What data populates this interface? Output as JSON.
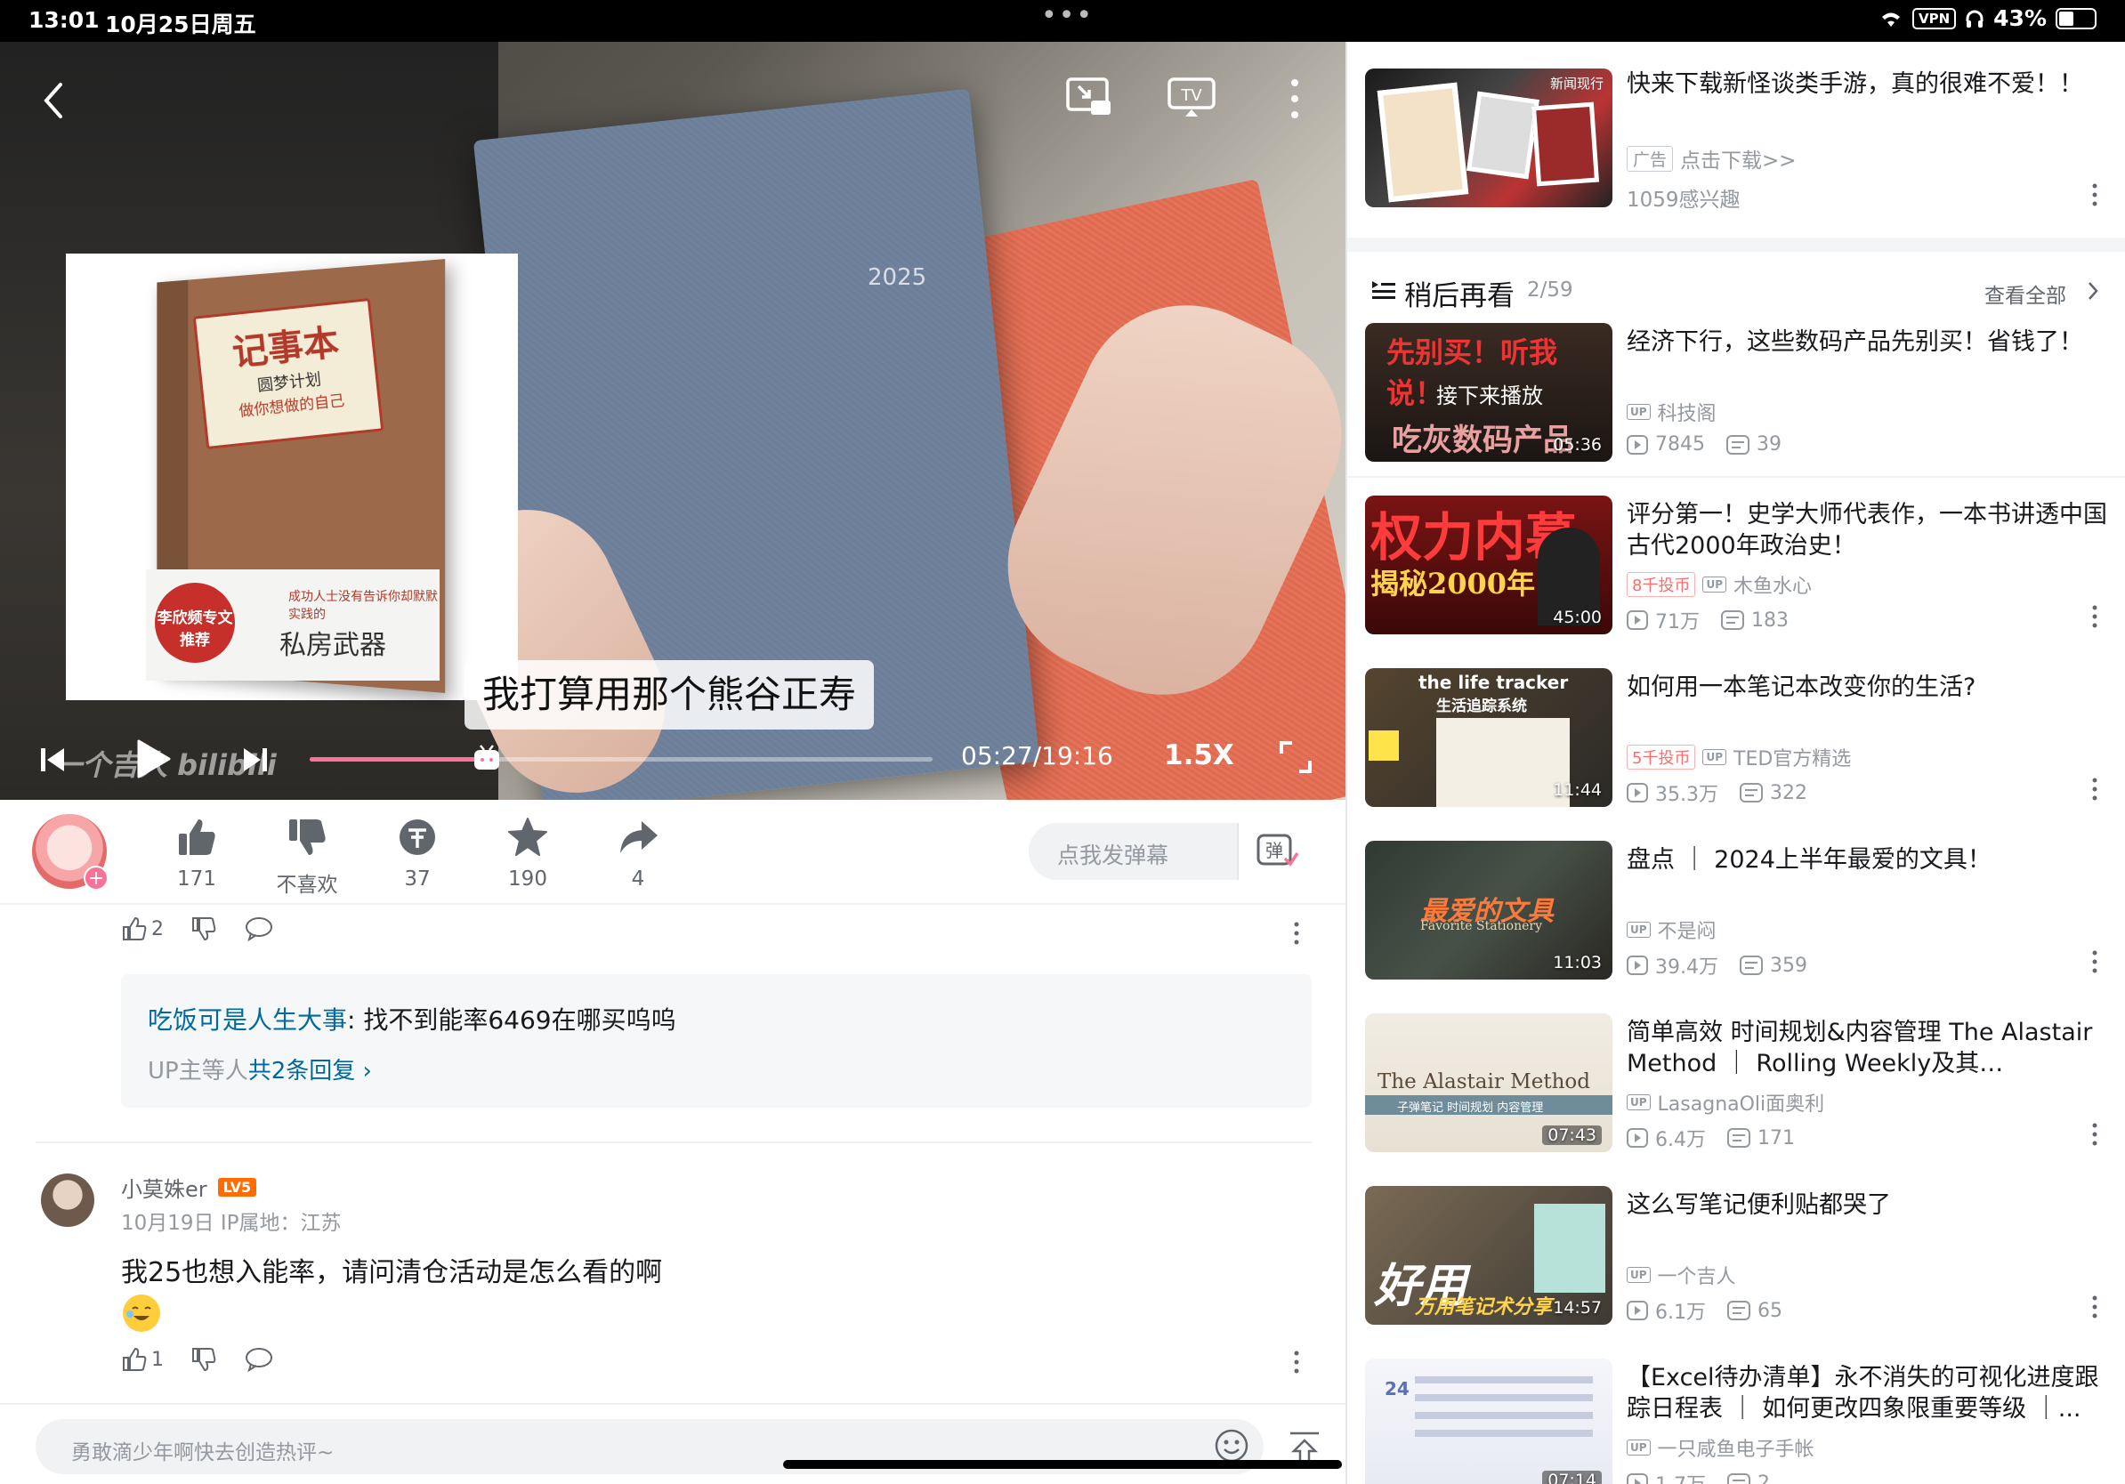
{
  "status_bar": {
    "time": "13:01",
    "date": "10月25日周五",
    "vpn": "VPN",
    "battery": "43%",
    "battery_level": 0.43
  },
  "player": {
    "subtitle": "我打算用那个熊谷正寿",
    "notebook_year": "2025",
    "book": {
      "title": "记事本",
      "subtitle": "圆梦计划",
      "tagline": "做你想做的自己",
      "cover_text": "成功人士没有告诉你却默默实践的",
      "cover_big": "私房武器",
      "stamp": "李欣频专文推荐"
    },
    "watermark": "一个吉人 bilibili",
    "time": "05:27/19:16",
    "progress": 0.284,
    "speed": "1.5X"
  },
  "actions": {
    "like_count": "171",
    "dislike_label": "不喜欢",
    "coin_count": "37",
    "fav_count": "190",
    "share_count": "4",
    "danmaku_placeholder": "点我发弹幕",
    "danmaku_btn": "弹"
  },
  "comments": {
    "first": {
      "likes": "2"
    },
    "reply_preview": {
      "name": "吃饭可是人生大事",
      "text": ": 找不到能率6469在哪买呜呜",
      "more_prefix": "UP主等人",
      "more_count": "共2条回复",
      "more_chevron": "›"
    },
    "second": {
      "user": "小莫姝er",
      "level": "LV5",
      "meta": "10月19日  IP属地：江苏",
      "text": "我25也想入能率，请问清仓活动是怎么看的啊",
      "likes": "1"
    },
    "input_placeholder": "勇敢滴少年啊快去创造热评~"
  },
  "sidebar": {
    "ad": {
      "title": "快来下载新怪谈类手游，真的很难不爱！！",
      "badge": "广告",
      "link": "点击下载>>",
      "interest": "1059感兴趣",
      "thumb_text": "新闻现行"
    },
    "later": {
      "title": "稍后再看",
      "count": "2/59",
      "view_all": "查看全部"
    },
    "videos": [
      {
        "title": "经济下行，这些数码产品先别买！省钱了！",
        "thumb_text": "先别买！听我说！",
        "overlay": "接下来播放",
        "thumb_text2": "吃灰数码产品",
        "duration": "05:36",
        "coin": "",
        "up": "科技阁",
        "views": "7845",
        "danmaku": "39"
      },
      {
        "title": "评分第一！史学大师代表作，一本书讲透中国古代2000年政治史！",
        "thumb_text": "权力内幕",
        "thumb_text2": "揭秘2000年",
        "duration": "45:00",
        "coin": "8千投币",
        "up": "木鱼水心",
        "views": "71万",
        "danmaku": "183"
      },
      {
        "title": "如何用一本笔记本改变你的生活?",
        "thumb_text": "the life tracker",
        "thumb_text2": "生活追踪系统",
        "duration": "11:44",
        "coin": "5千投币",
        "up": "TED官方精选",
        "views": "35.3万",
        "danmaku": "322"
      },
      {
        "title": "盘点 ｜ 2024上半年最爱的文具！",
        "thumb_text": "最爱的文具",
        "thumb_text2": "Favorite Stationery",
        "duration": "11:03",
        "coin": "",
        "up": "不是闷",
        "views": "39.4万",
        "danmaku": "359"
      },
      {
        "title": "简单高效  时间规划&内容管理  The Alastair  Method   ｜ Rolling  Weekly及其…",
        "thumb_text": "The Alastair Method",
        "thumb_text2": "子弹笔记 时间规划 内容管理",
        "duration": "07:43",
        "coin": "",
        "up": "LasagnaOli面奥利",
        "views": "6.4万",
        "danmaku": "171"
      },
      {
        "title": "这么写笔记便利贴都哭了",
        "thumb_text": "好用",
        "thumb_text2": "万用笔记术分享",
        "duration": "14:57",
        "coin": "",
        "up": "一个吉人",
        "views": "6.1万",
        "danmaku": "65"
      },
      {
        "title": "【Excel待办清单】永不消失的可视化进度跟踪日程表 ｜ 如何更改四象限重要等级 ｜...",
        "thumb_text": "24",
        "thumb_text2": "",
        "duration": "07:14",
        "coin": "",
        "up": "一只咸鱼电子手帐",
        "views": "1.7万",
        "danmaku": "2"
      }
    ]
  },
  "colors": {
    "brand_pink": "#fb7299",
    "link_blue": "#00699d",
    "text_secondary": "#9499a0",
    "level_orange": "#ff6c00"
  }
}
